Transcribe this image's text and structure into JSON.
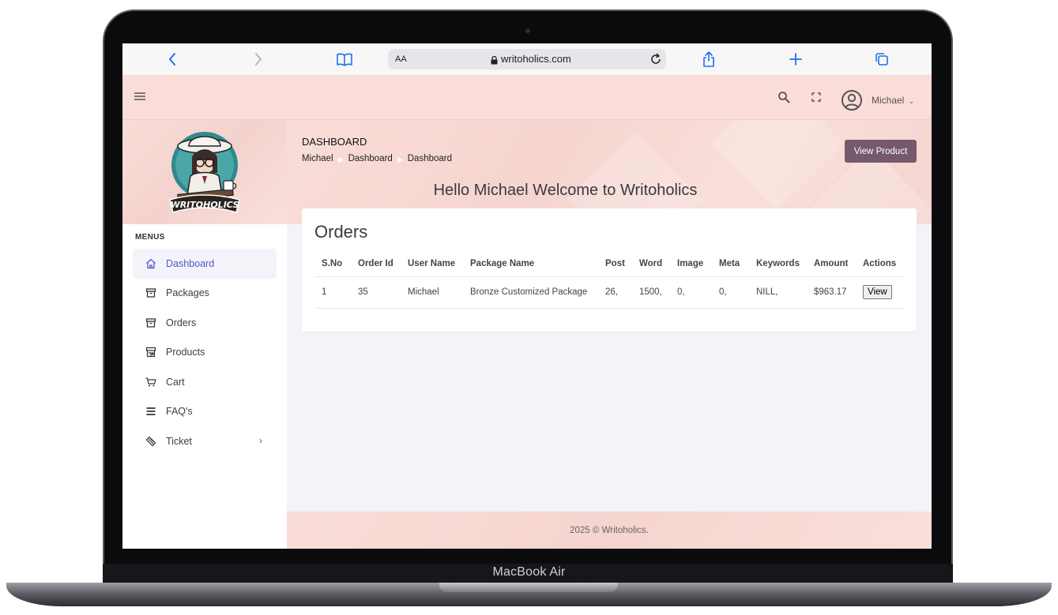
{
  "device": {
    "label": "MacBook Air"
  },
  "browser": {
    "text_size_label": "AA",
    "url": "writoholics.com",
    "icons": [
      "back-icon",
      "forward-icon",
      "bookmarks-icon",
      "lock-icon",
      "reload-icon",
      "share-icon",
      "new-tab-icon",
      "tabs-icon"
    ]
  },
  "header": {
    "username": "Michael",
    "icons": [
      "menu-icon",
      "search-icon",
      "fullscreen-icon",
      "user-avatar-icon",
      "chevron-down-icon"
    ]
  },
  "sidebar": {
    "logo_text": "WRITOHOLICS",
    "menu_title": "MENUS",
    "items": [
      {
        "label": "Dashboard",
        "icon": "home-icon",
        "active": true
      },
      {
        "label": "Packages",
        "icon": "archive-icon"
      },
      {
        "label": "Orders",
        "icon": "archive-icon"
      },
      {
        "label": "Products",
        "icon": "store-icon"
      },
      {
        "label": "Cart",
        "icon": "cart-icon"
      },
      {
        "label": "FAQ's",
        "icon": "list-icon"
      },
      {
        "label": "Ticket",
        "icon": "ticket-icon",
        "has_submenu": true
      }
    ]
  },
  "page": {
    "heading": "DASHBOARD",
    "breadcrumb": [
      "Michael",
      "Dashboard",
      "Dashboard"
    ],
    "primary_button": "View Product",
    "welcome": "Hello Michael Welcome to Writoholics"
  },
  "orders": {
    "title": "Orders",
    "columns": [
      "S.No",
      "Order Id",
      "User Name",
      "Package Name",
      "Post",
      "Word",
      "Image",
      "Meta",
      "Keywords",
      "Amount",
      "Actions"
    ],
    "rows": [
      {
        "sno": "1",
        "order_id": "35",
        "user": "Michael",
        "package": "Bronze Customized Package",
        "post": "26,",
        "word": "1500,",
        "image": "0,",
        "meta": "0,",
        "keywords": "NILL,",
        "amount": "$963.17",
        "action": "View"
      }
    ]
  },
  "footer": {
    "text": "2025 © Writoholics."
  },
  "colors": {
    "accent_pink": "#fadcd8",
    "button": "#76596c",
    "active_link": "#4f5ac7",
    "safari_blue": "#1e6ff0"
  }
}
